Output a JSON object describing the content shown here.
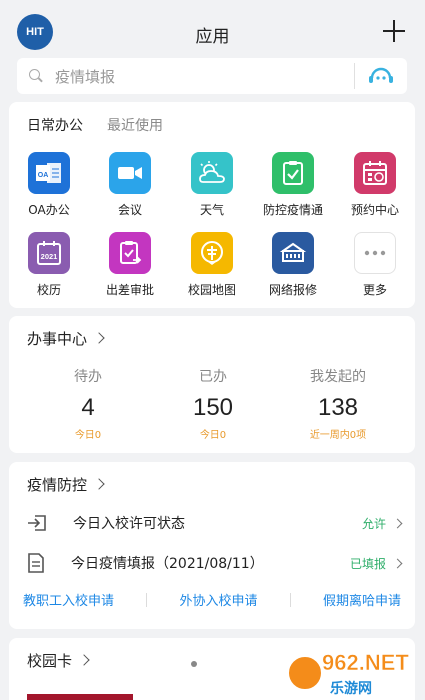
{
  "header": {
    "logo_text": "HIT",
    "title": "应用"
  },
  "search": {
    "placeholder": "疫情填报"
  },
  "apps": {
    "tabs": [
      "日常办公",
      "最近使用"
    ],
    "items": [
      {
        "label": "OA办公",
        "icon": "oa-icon",
        "color": "#1e72d8"
      },
      {
        "label": "会议",
        "icon": "video-icon",
        "color": "#2ba4ea"
      },
      {
        "label": "天气",
        "icon": "weather-icon",
        "color": "#35c3c9"
      },
      {
        "label": "防控疫情通",
        "icon": "clipboard-check-icon",
        "color": "#2fbf6a"
      },
      {
        "label": "预约中心",
        "icon": "calendar-icon",
        "color": "#d13a6a"
      },
      {
        "label": "校历",
        "icon": "calendar-2021-icon",
        "color": "#8a5cb0"
      },
      {
        "label": "出差审批",
        "icon": "approval-icon",
        "color": "#c336c0"
      },
      {
        "label": "校园地图",
        "icon": "map-pin-icon",
        "color": "#f5b800"
      },
      {
        "label": "网络报修",
        "icon": "network-icon",
        "color": "#2a5aa0"
      },
      {
        "label": "更多",
        "icon": "more-icon",
        "color": "#ffffff"
      }
    ]
  },
  "affairs": {
    "title": "办事中心",
    "stats": [
      {
        "label": "待办",
        "value": "4",
        "sub": "今日0"
      },
      {
        "label": "已办",
        "value": "150",
        "sub": "今日0"
      },
      {
        "label": "我发起的",
        "value": "138",
        "sub": "近一周内0项"
      }
    ]
  },
  "epidemic": {
    "title": "疫情防控",
    "rows": [
      {
        "text": "今日入校许可状态",
        "status": "允许"
      },
      {
        "text": "今日疫情填报（2021/08/11）",
        "status": "已填报"
      }
    ],
    "links": [
      "教职工入校申请",
      "外协入校申请",
      "假期离哈申请"
    ]
  },
  "campus": {
    "title": "校园卡"
  },
  "watermark": {
    "text": "962.NET",
    "sub": "乐游网"
  }
}
